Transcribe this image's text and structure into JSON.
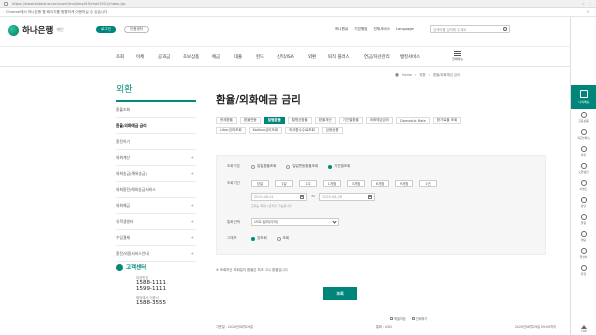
{
  "browser": {
    "url": "https://www.kebhana.com/cont/mall/mall15/mall1501/index.jsp"
  },
  "notice": {
    "text": "Chrome에서 하나은행 웹 페이지를 원활하게 이용하실 수 있습니다"
  },
  "header": {
    "logo_text": "하나은행",
    "logo_sub": "개인",
    "login_label": "로그인",
    "join_label": "인증센터",
    "util": [
      "하나원큐",
      "기업뱅킹",
      "전체서비스",
      "Language"
    ],
    "search_placeholder": "검색어를 입력해 주세요"
  },
  "gnb": {
    "items": [
      "조회",
      "이체",
      "공과금",
      "초보상품",
      "예금",
      "대출",
      "펀드",
      "신탁/ISA",
      "외환",
      "퇴직 플러스",
      "연금/자산관리",
      "외국인/고객용",
      "뱅킹서비스"
    ],
    "menu_label": "전체메뉴"
  },
  "breadcrumb": {
    "items": [
      "Home",
      "외환",
      "환율/외화예금 금리"
    ]
  },
  "lnb": {
    "title": "외환",
    "items": [
      {
        "label": "환율조회",
        "plus": ""
      },
      {
        "label": "환율/외화예금 금리",
        "plus": "",
        "active": true
      },
      {
        "label": "환전하기",
        "plus": ""
      },
      {
        "label": "외화계산",
        "plus": "+"
      },
      {
        "label": "외화송금(해외송금)",
        "plus": "+"
      },
      {
        "label": "외화환전/해외송금서비스",
        "plus": ""
      },
      {
        "label": "외화예금",
        "plus": "+"
      },
      {
        "label": "유학생센터",
        "plus": "+"
      },
      {
        "label": "수입결제",
        "plus": "+"
      },
      {
        "label": "환전/외환서비스안내",
        "plus": "+"
      }
    ]
  },
  "call_center": {
    "title": "고객센터",
    "entries": [
      {
        "label": "대표번호",
        "number": "1588-1111"
      },
      {
        "label": "",
        "number": "1599-1111"
      },
      {
        "label": "해외에서 이용시",
        "number": "1588-3555"
      }
    ]
  },
  "content": {
    "page_title": "환율/외화예금 금리",
    "tabs": [
      {
        "label": "현재환율",
        "active": false
      },
      {
        "label": "환율변동",
        "active": false
      },
      {
        "label": "일별환율",
        "active": true
      },
      {
        "label": "월평균환율",
        "active": false
      },
      {
        "label": "환율계산",
        "active": false
      },
      {
        "label": "기간별환율",
        "active": false
      },
      {
        "label": "외화예금금리",
        "active": false
      },
      {
        "label": "Domestic Rate",
        "active": false
      },
      {
        "label": "환가료율 조회",
        "active": false
      },
      {
        "label": "Libor금리조회",
        "active": false
      },
      {
        "label": "Koribor금리조회",
        "active": false
      },
      {
        "label": "외국환수수료조회",
        "active": false
      },
      {
        "label": "금융상품",
        "active": false
      }
    ],
    "form": {
      "type_label": "조회구분",
      "type_options": [
        {
          "label": "일일환율조회",
          "on": false
        },
        {
          "label": "일일변동환율조회",
          "on": false
        },
        {
          "label": "기간별조회",
          "on": true
        }
      ],
      "period_label": "조회기간",
      "period_buttons": [
        "당일",
        "1일",
        "1주",
        "1개월",
        "3개월",
        "6개월",
        "9개월",
        "1년"
      ],
      "start_date": "2020-06-01",
      "end_date": "2020-06-28",
      "date_hint": "조회는 최대 1년까지 가능합니다",
      "currency_label": "통화선택",
      "currency_value": "USD 달러(미국)",
      "chart_label": "그래프",
      "chart_options": [
        {
          "label": "표조회",
          "on": true
        },
        {
          "label": "조회",
          "on": false
        }
      ]
    },
    "note": "※ 조회하신 조회일자 환율은 최초 고시 환율입니다",
    "submit_label": "조회"
  },
  "footer": {
    "tools": [
      "엑셀저장",
      "인쇄하기"
    ],
    "base_date_label": "기준일 : 2020년06월29일",
    "currency_info": "통화 : USD",
    "time_info": "2020년06월29일 09:00까지"
  },
  "quickbar": {
    "head_label": "나의메뉴",
    "items": [
      "금융상품",
      "최근본메뉴",
      "외환",
      "오픈뱅킹",
      "이벤트",
      "상담",
      "알림",
      "채팅",
      "앱설치",
      "원큐"
    ],
    "top_label": "TOP"
  }
}
